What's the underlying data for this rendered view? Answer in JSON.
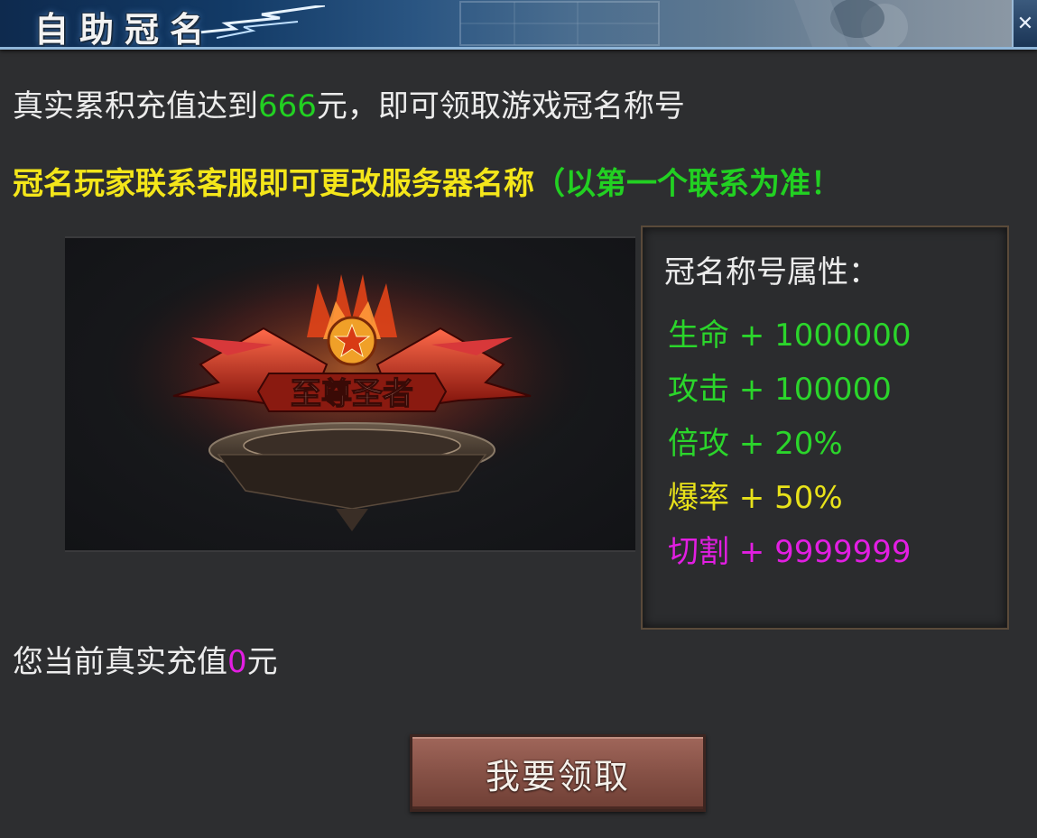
{
  "header": {
    "title": "自助冠名",
    "close_icon": "close-icon"
  },
  "intro": {
    "prefix": "真实累积充值达到",
    "amount": "666",
    "suffix": "元，即可领取游戏冠名称号"
  },
  "notice": {
    "main": "冠名玩家联系客服即可更改服务器名称",
    "note": "（以第一个联系为准！"
  },
  "showcase": {
    "badge_text": "至尊圣者"
  },
  "attributes": {
    "title": "冠名称号属性：",
    "items": [
      {
        "label": "生命 + 1000000",
        "color": "#2bd52b"
      },
      {
        "label": "攻击 + 100000",
        "color": "#2bd52b"
      },
      {
        "label": "倍攻 + 20%",
        "color": "#2bd52b"
      },
      {
        "label": "爆率 + 50%",
        "color": "#e8e21a"
      },
      {
        "label": "切割 + 9999999",
        "color": "#e21ee2"
      }
    ]
  },
  "recharge": {
    "prefix": "您当前真实充值",
    "value": "0",
    "suffix": "元"
  },
  "claim_button": {
    "label": "我要领取"
  },
  "colors": {
    "background": "#2d2e30",
    "highlight_green": "#22d022",
    "highlight_yellow": "#f4e61a",
    "highlight_magenta": "#e21ee2"
  }
}
